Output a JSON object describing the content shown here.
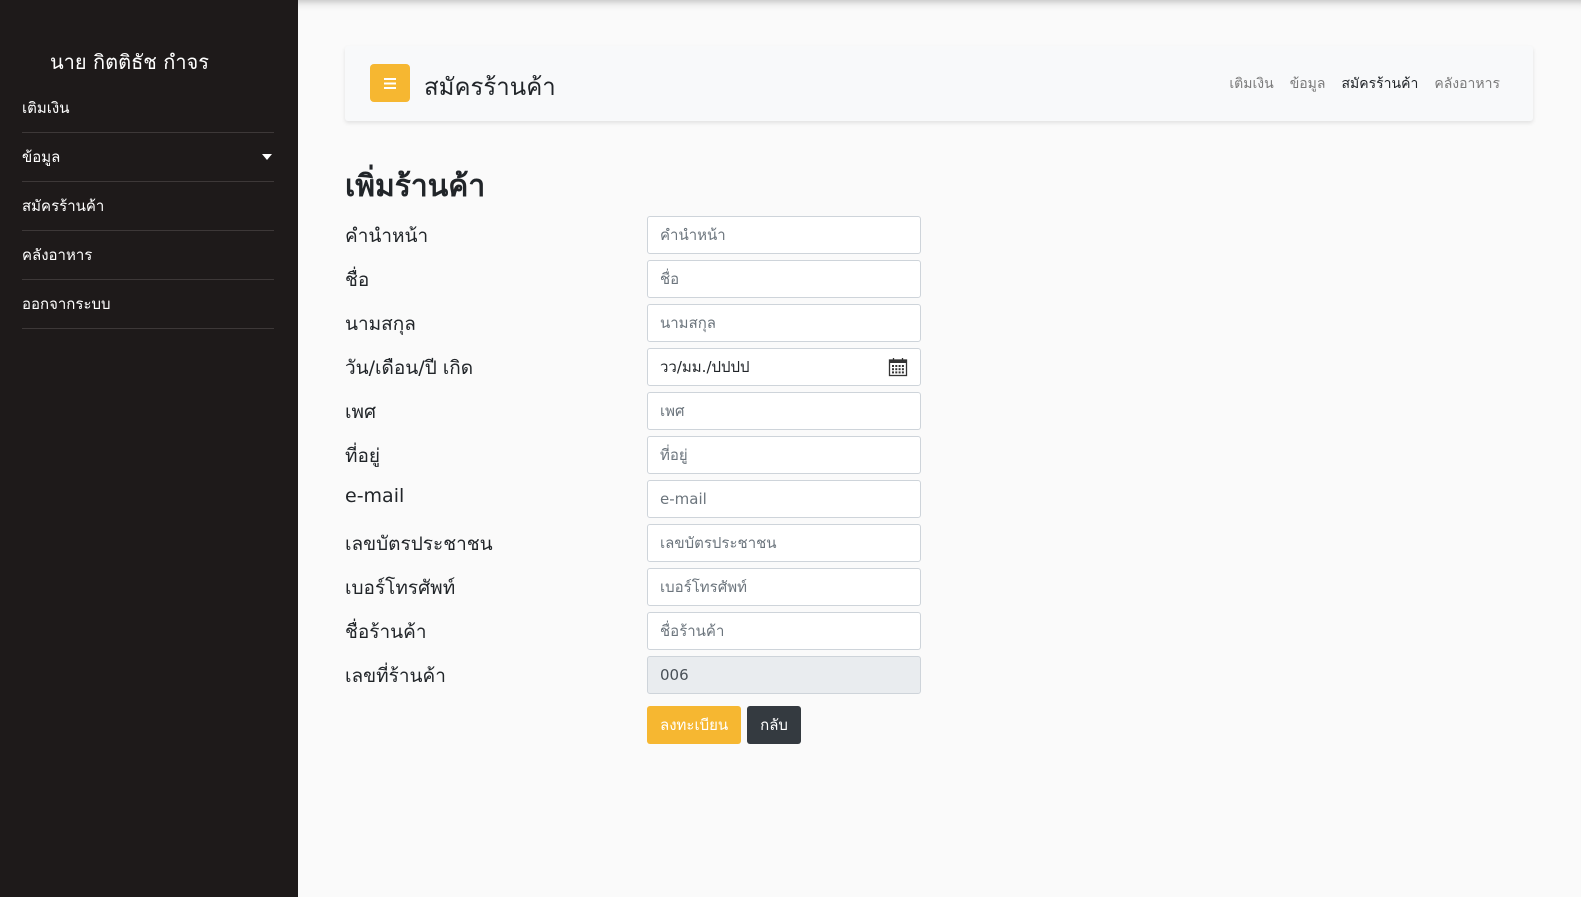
{
  "sidebar": {
    "user_name": "นาย กิตติธัช กำจร",
    "items": [
      {
        "label": "เติมเงิน"
      },
      {
        "label": "ข้อมูล",
        "has_dropdown": true
      },
      {
        "label": "สมัครร้านค้า"
      },
      {
        "label": "คลังอาหาร"
      },
      {
        "label": "ออกจากระบบ"
      }
    ]
  },
  "header": {
    "toggle_icon": "hamburger-icon",
    "title": "สมัครร้านค้า",
    "nav": [
      {
        "label": "เติมเงิน",
        "active": false
      },
      {
        "label": "ข้อมูล",
        "active": false
      },
      {
        "label": "สมัครร้านค้า",
        "active": true
      },
      {
        "label": "คลังอาหาร",
        "active": false
      }
    ]
  },
  "form": {
    "heading": "เพิ่มร้านค้า",
    "fields": [
      {
        "label": "คำนำหน้า",
        "placeholder": "คำนำหน้า",
        "value": ""
      },
      {
        "label": "ชื่อ",
        "placeholder": "ชื่อ",
        "value": ""
      },
      {
        "label": "นามสกุล",
        "placeholder": "นามสกุล",
        "value": ""
      },
      {
        "label": "วัน/เดือน/ปี เกิด",
        "placeholder": "วว/มม./ปปปป",
        "value": "",
        "type": "date"
      },
      {
        "label": "เพศ",
        "placeholder": "เพศ",
        "value": ""
      },
      {
        "label": "ที่อยู่",
        "placeholder": "ที่อยู่",
        "value": ""
      },
      {
        "label": "e-mail",
        "placeholder": "e-mail",
        "value": ""
      },
      {
        "label": "เลขบัตรประชาชน",
        "placeholder": "เลขบัตรประชาชน",
        "value": ""
      },
      {
        "label": "เบอร์โทรศัพท์",
        "placeholder": "เบอร์โทรศัพท์",
        "value": ""
      },
      {
        "label": "ชื่อร้านค้า",
        "placeholder": "ชื่อร้านค้า",
        "value": ""
      },
      {
        "label": "เลขที่ร้านค้า",
        "placeholder": "",
        "value": "006",
        "readonly": true
      }
    ],
    "submit_label": "ลงทะเบียน",
    "back_label": "กลับ"
  },
  "colors": {
    "sidebar_bg": "#1e1a1a",
    "accent": "#f6b731",
    "dark_button": "#343a40",
    "page_bg": "#fafafa"
  }
}
